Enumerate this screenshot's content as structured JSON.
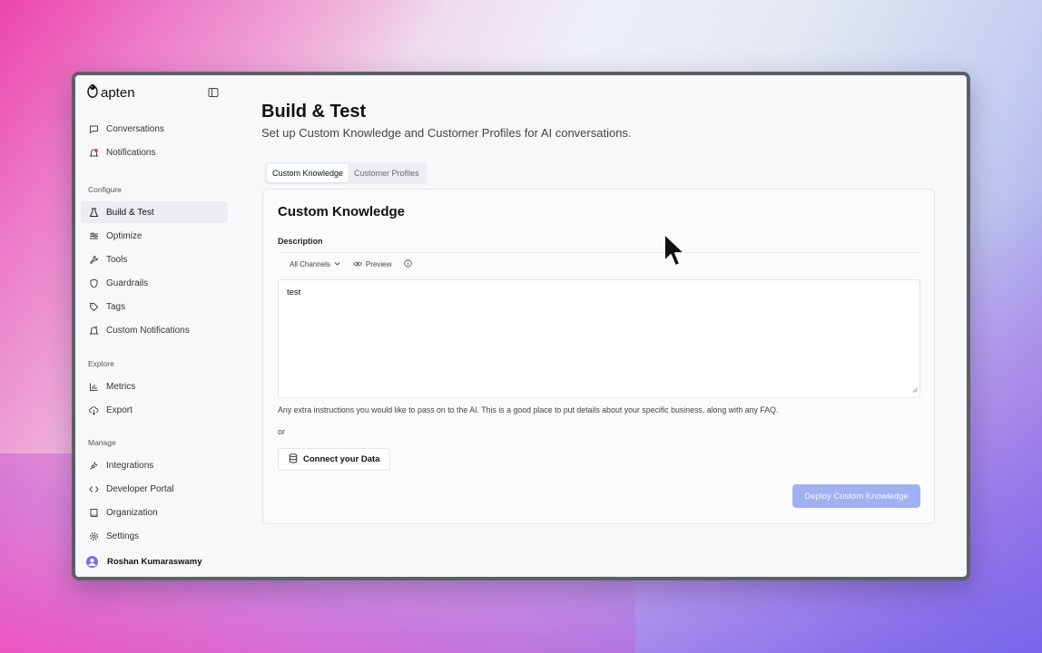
{
  "app": {
    "brand": "apten"
  },
  "sidebar": {
    "top_items": [
      {
        "label": "Conversations",
        "icon": "chat-icon"
      },
      {
        "label": "Notifications",
        "icon": "bell-icon"
      }
    ],
    "sections": [
      {
        "label": "Configure",
        "items": [
          {
            "label": "Build & Test",
            "icon": "flask-icon",
            "active": true
          },
          {
            "label": "Optimize",
            "icon": "sliders-icon"
          },
          {
            "label": "Tools",
            "icon": "wrench-icon"
          },
          {
            "label": "Guardrails",
            "icon": "shield-icon"
          },
          {
            "label": "Tags",
            "icon": "tag-icon"
          },
          {
            "label": "Custom Notifications",
            "icon": "bell-plus-icon"
          }
        ]
      },
      {
        "label": "Explore",
        "items": [
          {
            "label": "Metrics",
            "icon": "bar-chart-icon"
          },
          {
            "label": "Export",
            "icon": "cloud-download-icon"
          }
        ]
      },
      {
        "label": "Manage",
        "items": [
          {
            "label": "Integrations",
            "icon": "plug-icon"
          },
          {
            "label": "Developer Portal",
            "icon": "code-icon"
          },
          {
            "label": "Organization",
            "icon": "book-icon"
          },
          {
            "label": "Settings",
            "icon": "gear-icon"
          }
        ]
      }
    ],
    "user": {
      "name": "Roshan Kumaraswamy"
    }
  },
  "main": {
    "title": "Build & Test",
    "subtitle": "Set up Custom Knowledge and Customer Profiles for AI conversations.",
    "tabs": [
      {
        "label": "Custom Knowledge",
        "active": true
      },
      {
        "label": "Customer Profiles",
        "active": false
      }
    ],
    "card": {
      "title": "Custom Knowledge",
      "description_label": "Description",
      "toolbar": {
        "channel_select": "All Channels",
        "preview": "Preview"
      },
      "textarea_value": "test",
      "helper_text": "Any extra instructions you would like to pass on to the AI. This is a good place to put details about your specific business, along with any FAQ.",
      "or_text": "or",
      "connect_button": "Connect your Data",
      "deploy_button": "Deploy Custom Knowledge"
    }
  },
  "colors": {
    "accent_disabled": "#9fb1f3",
    "avatar": "#7a6ee8",
    "notification_dot": "#e0457b"
  }
}
